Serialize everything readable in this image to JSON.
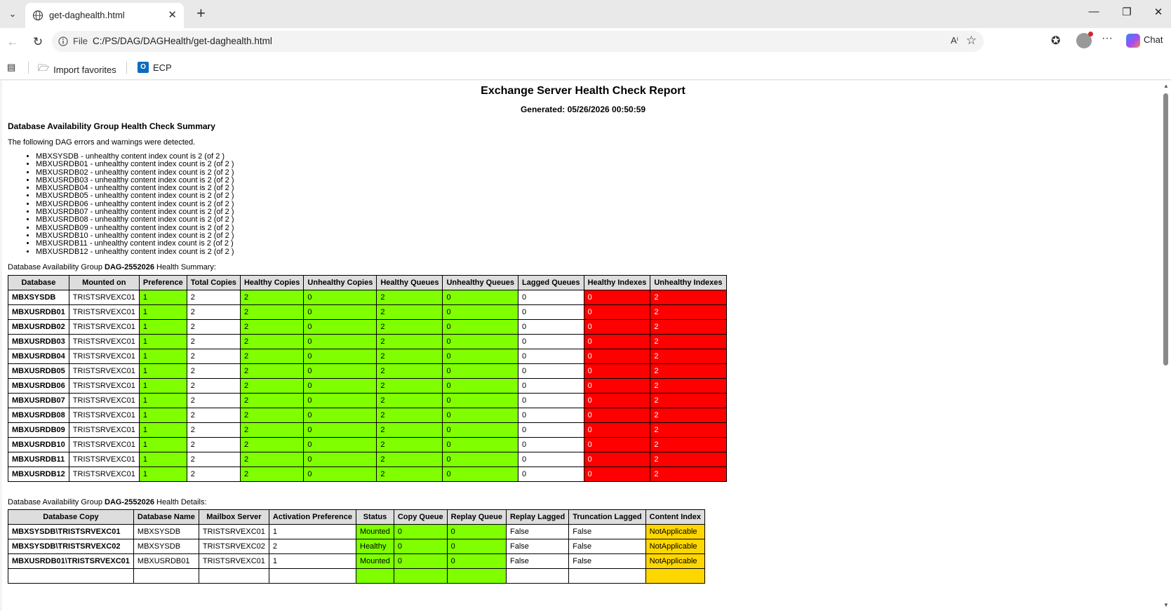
{
  "browser": {
    "tab_title": "get-daghealth.html",
    "address_scheme": "File",
    "address_url": "C:/PS/DAG/DAGHealth/get-daghealth.html",
    "chat_label": "Chat",
    "favorites": [
      {
        "label": "Import favorites"
      },
      {
        "label": "ECP"
      }
    ]
  },
  "report": {
    "title": "Exchange Server Health Check Report",
    "generated": "Generated: 05/26/2026 00:50:59",
    "summary_heading": "Database Availability Group Health Check Summary",
    "intro": "The following DAG errors and warnings were detected.",
    "errors": [
      "MBXSYSDB - unhealthy content index count is 2 (of 2 )",
      "MBXUSRDB01 - unhealthy content index count is 2 (of 2 )",
      "MBXUSRDB02 - unhealthy content index count is 2 (of 2 )",
      "MBXUSRDB03 - unhealthy content index count is 2 (of 2 )",
      "MBXUSRDB04 - unhealthy content index count is 2 (of 2 )",
      "MBXUSRDB05 - unhealthy content index count is 2 (of 2 )",
      "MBXUSRDB06 - unhealthy content index count is 2 (of 2 )",
      "MBXUSRDB07 - unhealthy content index count is 2 (of 2 )",
      "MBXUSRDB08 - unhealthy content index count is 2 (of 2 )",
      "MBXUSRDB09 - unhealthy content index count is 2 (of 2 )",
      "MBXUSRDB10 - unhealthy content index count is 2 (of 2 )",
      "MBXUSRDB11 - unhealthy content index count is 2 (of 2 )",
      "MBXUSRDB12 - unhealthy content index count is 2 (of 2 )"
    ],
    "summary_caption_prefix": "Database Availability Group ",
    "dag_name": "DAG-2552026",
    "summary_caption_suffix": " Health Summary:",
    "details_caption_suffix": " Health Details:",
    "summary_table": {
      "headers": [
        "Database",
        "Mounted on",
        "Preference",
        "Total Copies",
        "Healthy Copies",
        "Unhealthy Copies",
        "Healthy Queues",
        "Unhealthy Queues",
        "Lagged Queues",
        "Healthy Indexes",
        "Unhealthy Indexes"
      ],
      "rows": [
        [
          "MBXSYSDB",
          "TRISTSRVEXC01",
          "1",
          "2",
          "2",
          "0",
          "2",
          "0",
          "0",
          "0",
          "2"
        ],
        [
          "MBXUSRDB01",
          "TRISTSRVEXC01",
          "1",
          "2",
          "2",
          "0",
          "2",
          "0",
          "0",
          "0",
          "2"
        ],
        [
          "MBXUSRDB02",
          "TRISTSRVEXC01",
          "1",
          "2",
          "2",
          "0",
          "2",
          "0",
          "0",
          "0",
          "2"
        ],
        [
          "MBXUSRDB03",
          "TRISTSRVEXC01",
          "1",
          "2",
          "2",
          "0",
          "2",
          "0",
          "0",
          "0",
          "2"
        ],
        [
          "MBXUSRDB04",
          "TRISTSRVEXC01",
          "1",
          "2",
          "2",
          "0",
          "2",
          "0",
          "0",
          "0",
          "2"
        ],
        [
          "MBXUSRDB05",
          "TRISTSRVEXC01",
          "1",
          "2",
          "2",
          "0",
          "2",
          "0",
          "0",
          "0",
          "2"
        ],
        [
          "MBXUSRDB06",
          "TRISTSRVEXC01",
          "1",
          "2",
          "2",
          "0",
          "2",
          "0",
          "0",
          "0",
          "2"
        ],
        [
          "MBXUSRDB07",
          "TRISTSRVEXC01",
          "1",
          "2",
          "2",
          "0",
          "2",
          "0",
          "0",
          "0",
          "2"
        ],
        [
          "MBXUSRDB08",
          "TRISTSRVEXC01",
          "1",
          "2",
          "2",
          "0",
          "2",
          "0",
          "0",
          "0",
          "2"
        ],
        [
          "MBXUSRDB09",
          "TRISTSRVEXC01",
          "1",
          "2",
          "2",
          "0",
          "2",
          "0",
          "0",
          "0",
          "2"
        ],
        [
          "MBXUSRDB10",
          "TRISTSRVEXC01",
          "1",
          "2",
          "2",
          "0",
          "2",
          "0",
          "0",
          "0",
          "2"
        ],
        [
          "MBXUSRDB11",
          "TRISTSRVEXC01",
          "1",
          "2",
          "2",
          "0",
          "2",
          "0",
          "0",
          "0",
          "2"
        ],
        [
          "MBXUSRDB12",
          "TRISTSRVEXC01",
          "1",
          "2",
          "2",
          "0",
          "2",
          "0",
          "0",
          "0",
          "2"
        ]
      ],
      "cell_status": [
        "db",
        "plain",
        "pass",
        "plain",
        "pass",
        "pass",
        "pass",
        "pass",
        "plain",
        "fail",
        "fail"
      ]
    },
    "details_table": {
      "headers": [
        "Database Copy",
        "Database Name",
        "Mailbox Server",
        "Activation Preference",
        "Status",
        "Copy Queue",
        "Replay Queue",
        "Replay Lagged",
        "Truncation Lagged",
        "Content Index"
      ],
      "rows": [
        [
          "MBXSYSDB\\TRISTSRVEXC01",
          "MBXSYSDB",
          "TRISTSRVEXC01",
          "1",
          "Mounted",
          "0",
          "0",
          "False",
          "False",
          "NotApplicable"
        ],
        [
          "MBXSYSDB\\TRISTSRVEXC02",
          "MBXSYSDB",
          "TRISTSRVEXC02",
          "2",
          "Healthy",
          "0",
          "0",
          "False",
          "False",
          "NotApplicable"
        ],
        [
          "MBXUSRDB01\\TRISTSRVEXC01",
          "MBXUSRDB01",
          "TRISTSRVEXC01",
          "1",
          "Mounted",
          "0",
          "0",
          "False",
          "False",
          "NotApplicable"
        ],
        [
          "",
          "",
          "",
          "",
          "",
          "",
          "",
          "",
          "",
          ""
        ]
      ],
      "cell_status": [
        "db",
        "plain",
        "plain",
        "plain",
        "pass",
        "pass",
        "pass",
        "plain",
        "plain",
        "warn"
      ]
    }
  },
  "colors": {
    "pass": "#7fff00",
    "fail": "#ff0000",
    "warn": "#ffd700",
    "header": "#dddddd"
  },
  "icons": [
    "tab-list-icon",
    "globe-icon",
    "close-icon",
    "new-tab-icon",
    "minimize-icon",
    "maximize-icon",
    "window-close-icon",
    "back-icon",
    "refresh-icon",
    "info-icon",
    "read-aloud-icon",
    "favorite-star-icon",
    "favorites-icon",
    "profile-avatar",
    "more-icon",
    "copilot-icon",
    "sidebar-icon",
    "import-icon",
    "outlook-icon"
  ]
}
